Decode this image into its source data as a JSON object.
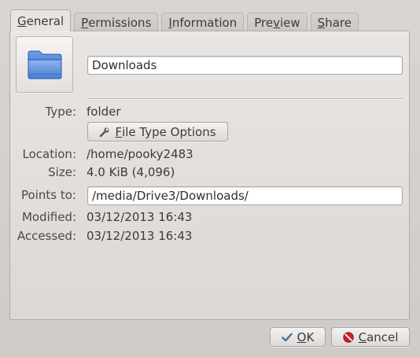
{
  "tabs": [
    {
      "label": "General",
      "mnemonic": "G",
      "rest": "eneral",
      "active": true
    },
    {
      "label": "Permissions",
      "mnemonic": "P",
      "rest": "ermissions",
      "active": false
    },
    {
      "label": "Information",
      "mnemonic": "I",
      "rest": "nformation",
      "active": false
    },
    {
      "label": "Preview",
      "mnemonic": "v",
      "pre": "Pre",
      "rest": "iew",
      "active": false
    },
    {
      "label": "Share",
      "mnemonic": "S",
      "rest": "hare",
      "active": false
    }
  ],
  "general": {
    "name_value": "Downloads",
    "type_label": "Type:",
    "type_value": "folder",
    "filetype_button": {
      "pre": "",
      "mnemonic": "F",
      "rest": "ile Type Options",
      "icon": "wrench-icon"
    },
    "location_label": "Location:",
    "location_value": "/home/pooky2483",
    "size_label": "Size:",
    "size_value": "4.0 KiB (4,096)",
    "points_to_label": "Points to:",
    "points_to_value": "/media/Drive3/Downloads/",
    "modified_label": "Modified:",
    "modified_value": "03/12/2013 16:43",
    "accessed_label": "Accessed:",
    "accessed_value": "03/12/2013 16:43",
    "folder_icon": "folder-icon",
    "folder_color": "#4a7fd4"
  },
  "footer": {
    "ok": {
      "mnemonic": "O",
      "rest": "K",
      "icon": "checkmark-icon"
    },
    "cancel": {
      "mnemonic": "C",
      "rest": "ancel",
      "icon": "cancel-icon"
    }
  }
}
